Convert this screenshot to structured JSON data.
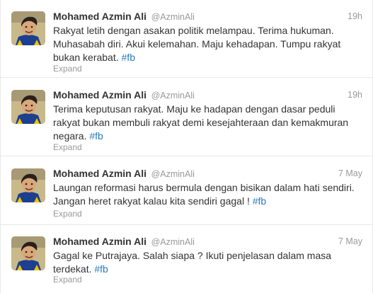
{
  "colors": {
    "name": "#333333",
    "meta": "#999999",
    "link": "#2a7bbd",
    "divider": "#e8e8e8"
  },
  "tweets": [
    {
      "fullname": "Mohamed Azmin Ali",
      "username": "@AzminAli",
      "time": "19h",
      "text": "Rakyat letih dengan asakan politik melampau. Terima hukuman. Muhasabah diri. Akui kelemahan. Maju kehadapan. Tumpu rakyat bukan kerabat.",
      "hashtag": "#fb",
      "expand": "Expand"
    },
    {
      "fullname": "Mohamed Azmin Ali",
      "username": "@AzminAli",
      "time": "19h",
      "text": "Terima keputusan rakyat. Maju ke hadapan dengan dasar peduli rakyat bukan membuli rakyat demi kesejahteraan dan kemakmuran negara.",
      "hashtag": "#fb",
      "expand": "Expand"
    },
    {
      "fullname": "Mohamed Azmin Ali",
      "username": "@AzminAli",
      "time": "7 May",
      "text": "Laungan reformasi harus bermula dengan bisikan dalam hati sendiri. Jangan heret rakyat kalau kita sendiri gagal !",
      "hashtag": "#fb",
      "expand": "Expand"
    },
    {
      "fullname": "Mohamed Azmin Ali",
      "username": "@AzminAli",
      "time": "7 May",
      "text": "Gagal ke Putrajaya. Salah siapa ? Ikuti penjelasan dalam masa terdekat.",
      "hashtag": "#fb",
      "expand": "Expand"
    }
  ]
}
